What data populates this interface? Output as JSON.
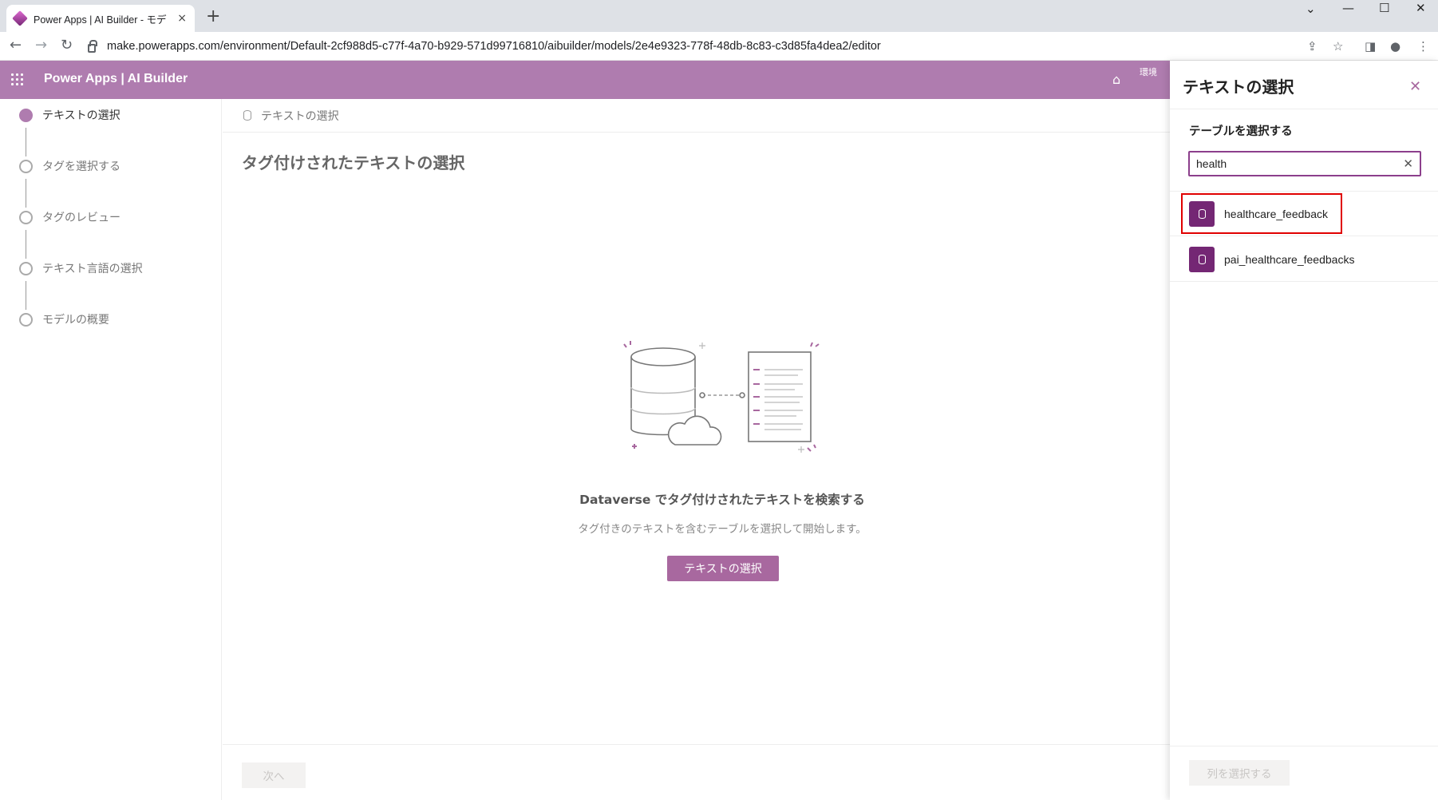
{
  "browser": {
    "tab_title": "Power Apps | AI Builder - モデ",
    "tab_close": "×",
    "new_tab": "+",
    "url": "make.powerapps.com/environment/Default-2cf988d5-c77f-4a70-b929-571d99716810/aibuilder/models/2e4e9323-778f-48db-8c83-c3d85fa4dea2/editor"
  },
  "app": {
    "title": "Power Apps  |  AI Builder",
    "env_label": "環境"
  },
  "steps": [
    {
      "label": "テキストの選択",
      "active": true
    },
    {
      "label": "タグを選択する",
      "active": false
    },
    {
      "label": "タグのレビュー",
      "active": false
    },
    {
      "label": "テキスト言語の選択",
      "active": false
    },
    {
      "label": "モデルの概要",
      "active": false
    }
  ],
  "main": {
    "breadcrumb": "テキストの選択",
    "title": "タグ付けされたテキストの選択",
    "empty_heading": "Dataverse でタグ付けされたテキストを検索する",
    "empty_sub": "タグ付きのテキストを含むテーブルを選択して開始します。",
    "select_button": "テキストの選択",
    "next_button": "次へ"
  },
  "panel": {
    "title": "テキストの選択",
    "close": "✕",
    "table_label": "テーブルを選択する",
    "search_value": "health",
    "clear": "✕",
    "results": [
      "healthcare_feedback",
      "pai_healthcare_feedbacks"
    ],
    "columns_button": "列を選択する"
  },
  "colors": {
    "appbar": "#af7caf",
    "accent": "#742774",
    "highlight": "#e00000"
  }
}
